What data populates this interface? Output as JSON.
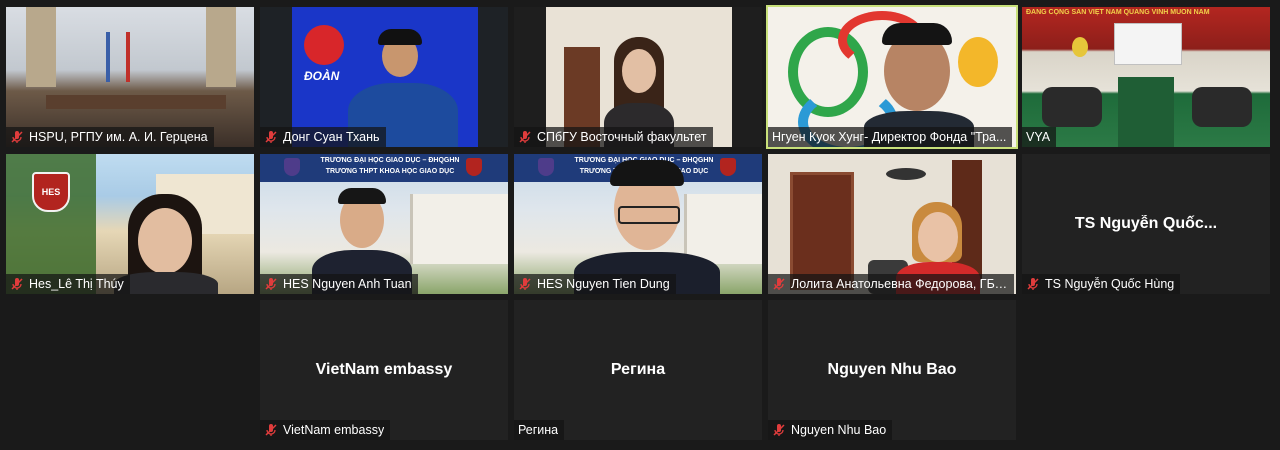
{
  "tiles": [
    {
      "name": "HSPU, РГПУ им. А. И. Герцена",
      "video": true
    },
    {
      "name": "Донг Суан Тхань",
      "video": true
    },
    {
      "name": "СПбГУ Восточный факультет",
      "video": true
    },
    {
      "name": "Нгуен Куок Хунг- Директор Фонда \"Тра...",
      "video": true,
      "active": true
    },
    {
      "name": "VYA",
      "video": true
    },
    {
      "name": "Hes_Lê Thị Thúy",
      "video": true
    },
    {
      "name": "HES Nguyen Anh Tuan",
      "video": true
    },
    {
      "name": "HES Nguyen Tien Dung",
      "video": true
    },
    {
      "name": "Лолита Анатольевна Федорова, ГБО...",
      "video": true
    },
    {
      "name": "TS Nguyễn Quốc Hùng",
      "center": "TS Nguyễn Quốc...",
      "video": false
    },
    {
      "name": "VietNam embassy",
      "center": "VietNam embassy",
      "video": false
    },
    {
      "name": "Регина",
      "center": "Регина",
      "video": false
    },
    {
      "name": "Nguyen Nhu Bao",
      "center": "Nguyen Nhu Bao",
      "video": false
    }
  ],
  "video_overlays": {
    "doan_logo": "ĐOÀN",
    "hes_banner_line1": "TRƯỜNG ĐẠI HỌC GIÁO DỤC – ĐHQGHN",
    "hes_banner_line2": "TRƯỜNG THPT KHOA HỌC GIÁO DỤC",
    "hes_shield": "HES",
    "vya_banner": "ĐẢNG CỘNG SẢN VIỆT NAM QUANG VINH MUÔN NĂM"
  },
  "colors": {
    "background": "#1a1a1a",
    "tile": "#222222",
    "active_border": "#c8e07a",
    "muted_mic": "#e03c3c"
  }
}
